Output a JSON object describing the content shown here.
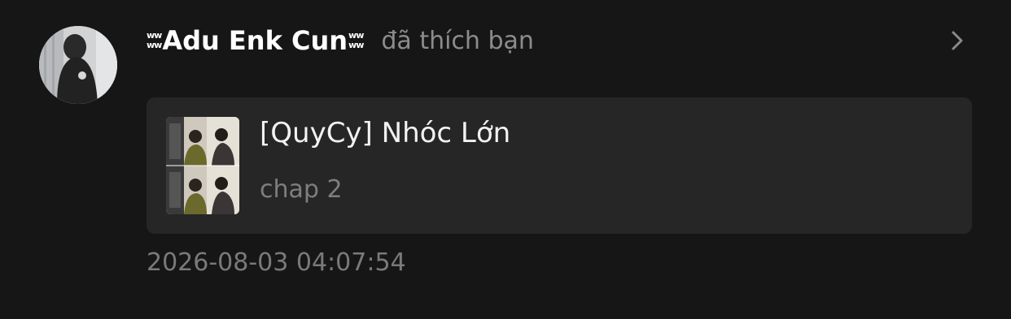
{
  "notification": {
    "user": {
      "name": "Adu Enk Cun",
      "decoration_left": [
        "ww",
        "ww"
      ],
      "decoration_right": [
        "ww",
        "ww"
      ]
    },
    "action": "đã thích bạn",
    "story": {
      "title": "[QuyCy] Nhóc Lớn",
      "chapter": "chap 2"
    },
    "timestamp": "2026-08-03 04:07:54"
  },
  "icons": {
    "chevron": "chevron-right-icon"
  },
  "colors": {
    "background": "#161616",
    "card": "#262626",
    "primary_text": "#ffffff",
    "secondary_text": "#8c8c8c"
  }
}
